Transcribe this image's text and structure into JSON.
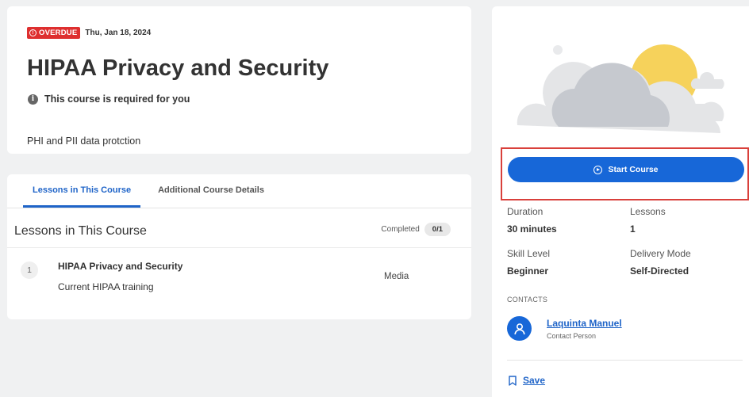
{
  "course": {
    "overdue_label": "OVERDUE",
    "overdue_icon": "alert-circle-icon",
    "due_date": "Thu, Jan 18, 2024",
    "title": "HIPAA Privacy and Security",
    "required_text": "This course is required for you",
    "info_icon_glyph": "i",
    "description": "PHI and PII data protction"
  },
  "tabs": [
    {
      "label": "Lessons in This Course",
      "active": true
    },
    {
      "label": "Additional Course Details",
      "active": false
    }
  ],
  "lessons": {
    "heading": "Lessons in This Course",
    "completed_label": "Completed",
    "completed_count": "0/1",
    "items": [
      {
        "number": "1",
        "title": "HIPAA Privacy and Security",
        "subtitle": "Current HIPAA training",
        "type": "Media"
      }
    ]
  },
  "sidebar": {
    "start_button_label": "Start Course",
    "start_icon": "play-circle-icon",
    "duration_label": "Duration",
    "duration_value": "30 minutes",
    "lessons_label": "Lessons",
    "lessons_value": "1",
    "skill_label": "Skill Level",
    "skill_value": "Beginner",
    "delivery_label": "Delivery Mode",
    "delivery_value": "Self-Directed",
    "contacts_label": "CONTACTS",
    "contact_name": "Laquinta Manuel",
    "contact_role": "Contact Person",
    "save_label": "Save"
  },
  "colors": {
    "accent": "#1767d8",
    "overdue": "#de2f2f",
    "highlight_border": "#d9403b"
  }
}
